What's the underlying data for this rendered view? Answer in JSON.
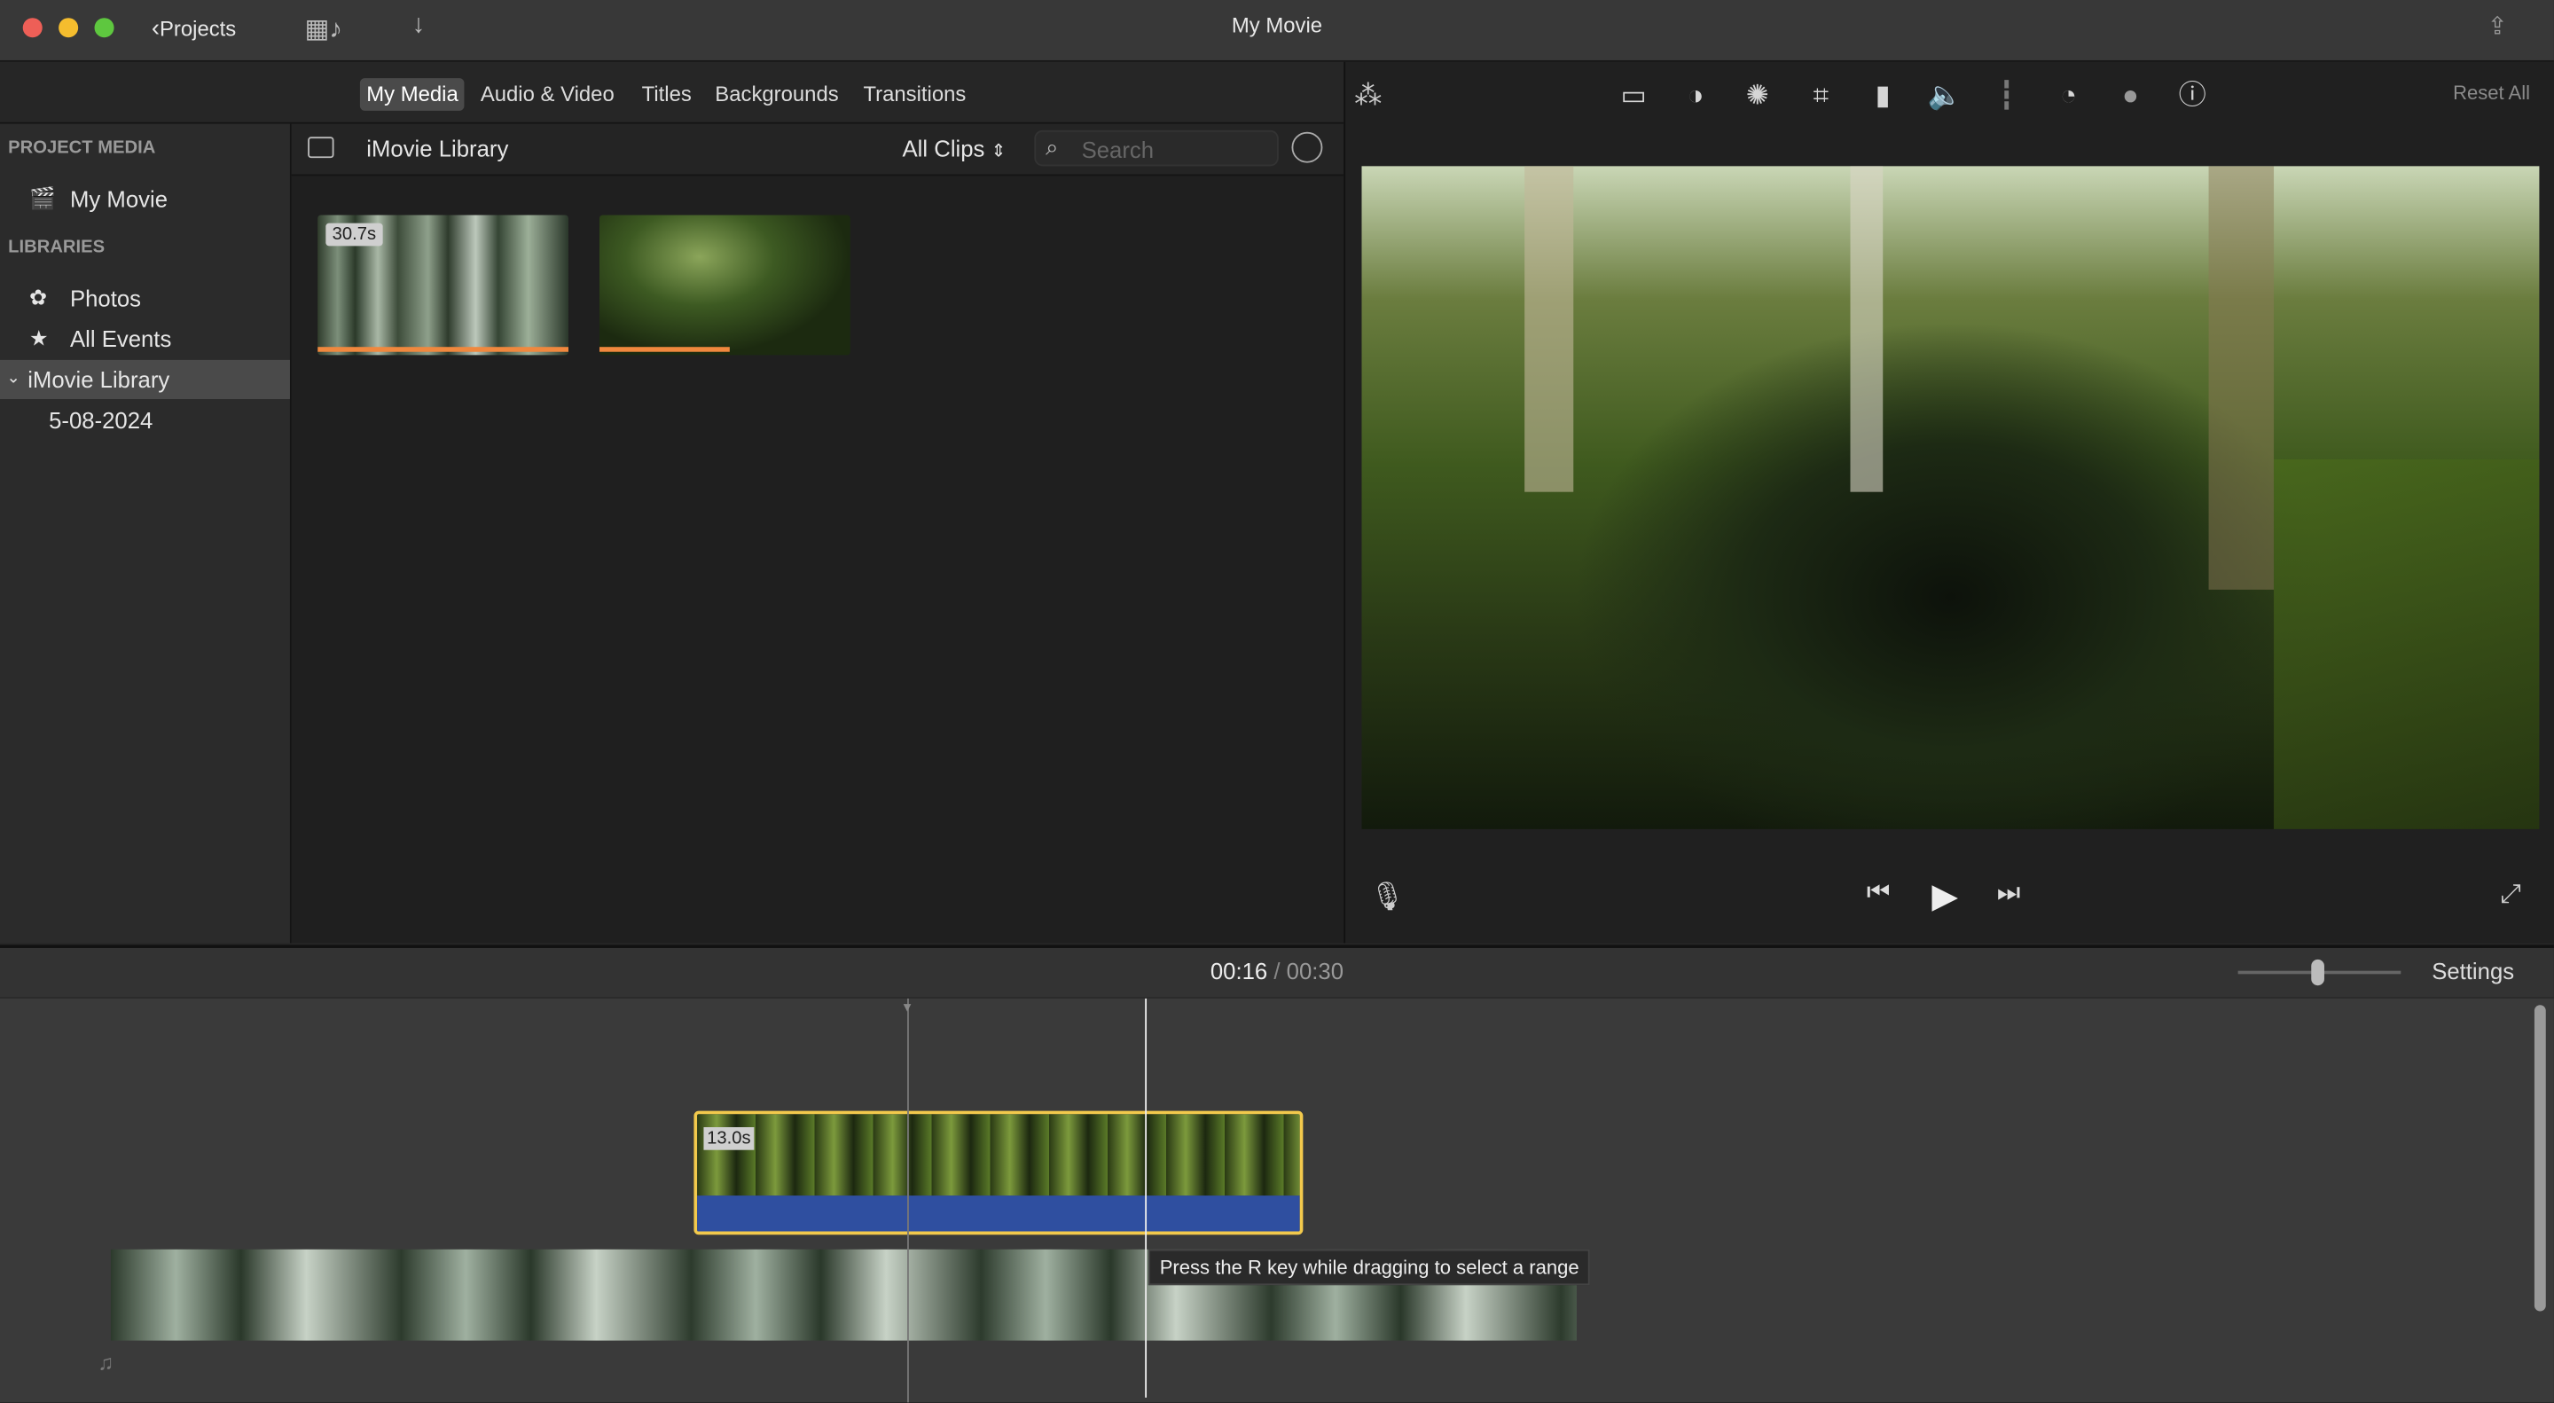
{
  "window": {
    "title": "My Movie",
    "back_label": "Projects"
  },
  "tabs": [
    {
      "label": "My Media",
      "active": true
    },
    {
      "label": "Audio & Video"
    },
    {
      "label": "Titles"
    },
    {
      "label": "Backgrounds"
    },
    {
      "label": "Transitions"
    }
  ],
  "sidebar": {
    "project_media_header": "PROJECT MEDIA",
    "project_item": "My Movie",
    "libraries_header": "LIBRARIES",
    "items": [
      "Photos",
      "All Events",
      "iMovie Library",
      "5-08-2024"
    ]
  },
  "browser": {
    "title": "iMovie Library",
    "filter": "All Clips",
    "search_placeholder": "Search",
    "clips": [
      {
        "duration": "30.7s",
        "used_fraction": 1.0
      },
      {
        "used_fraction": 0.52
      }
    ]
  },
  "viewer": {
    "reset_label": "Reset All",
    "tools": [
      "magic-wand",
      "crop-to-fill",
      "color-balance",
      "color-correction",
      "crop",
      "stabilization",
      "volume",
      "noise-reduction",
      "speed",
      "clip-filter",
      "info"
    ]
  },
  "timeline": {
    "current_time": "00:16",
    "separator": "/",
    "total_time": "00:30",
    "settings_label": "Settings",
    "zoom_level": 0.5,
    "selected_clip_duration": "13.0s",
    "tooltip": "Press the R key while dragging to select a range"
  },
  "colors": {
    "accent": "#f2c94c",
    "audio": "#2f4fa0",
    "used": "#f0883e"
  }
}
